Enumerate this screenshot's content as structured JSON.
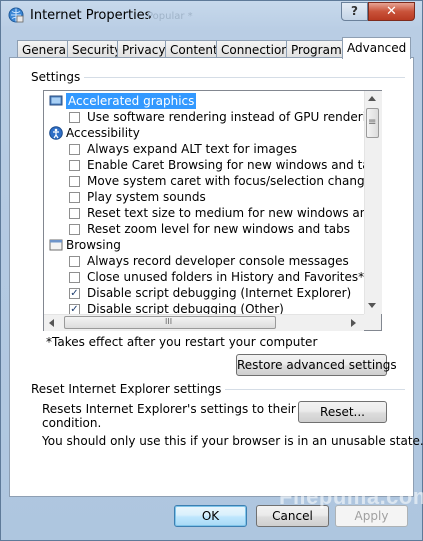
{
  "window": {
    "title": "Internet Properties",
    "background_title": "Popular *",
    "help_glyph": "?",
    "close_glyph": "✕"
  },
  "tabs": [
    {
      "label": "General"
    },
    {
      "label": "Security"
    },
    {
      "label": "Privacy"
    },
    {
      "label": "Content"
    },
    {
      "label": "Connections"
    },
    {
      "label": "Programs"
    },
    {
      "label": "Advanced",
      "active": true
    }
  ],
  "settings": {
    "group_label": "Settings",
    "items": [
      {
        "type": "category",
        "icon": "monitor-icon",
        "label": "Accelerated graphics",
        "selected": true
      },
      {
        "type": "checkbox",
        "label": "Use software rendering instead of GPU rendering*",
        "checked": false
      },
      {
        "type": "category",
        "icon": "accessibility-icon",
        "label": "Accessibility"
      },
      {
        "type": "checkbox",
        "label": "Always expand ALT text for images",
        "checked": false
      },
      {
        "type": "checkbox",
        "label": "Enable Caret Browsing for new windows and tabs",
        "checked": false
      },
      {
        "type": "checkbox",
        "label": "Move system caret with focus/selection changes",
        "checked": false
      },
      {
        "type": "checkbox",
        "label": "Play system sounds",
        "checked": false
      },
      {
        "type": "checkbox",
        "label": "Reset text size to medium for new windows and tabs",
        "checked": false
      },
      {
        "type": "checkbox",
        "label": "Reset zoom level for new windows and tabs",
        "checked": false
      },
      {
        "type": "category",
        "icon": "browsing-icon",
        "label": "Browsing"
      },
      {
        "type": "checkbox",
        "label": "Always record developer console messages",
        "checked": false
      },
      {
        "type": "checkbox",
        "label": "Close unused folders in History and Favorites*",
        "checked": false
      },
      {
        "type": "checkbox",
        "label": "Disable script debugging (Internet Explorer)",
        "checked": true
      },
      {
        "type": "checkbox",
        "label": "Disable script debugging (Other)",
        "checked": true
      }
    ],
    "check_glyph": "✓",
    "hscroll_grip": "III",
    "vscroll_grip": "≡",
    "footnote": "*Takes effect after you restart your computer",
    "restore_button": "Restore advanced settings"
  },
  "reset": {
    "group_label": "Reset Internet Explorer settings",
    "description_line1": "Resets Internet Explorer's settings to their default",
    "description_line2": "condition.",
    "reset_button": "Reset...",
    "warning": "You should only use this if your browser is in an unusable state."
  },
  "buttons": {
    "ok": "OK",
    "cancel": "Cancel",
    "apply": "Apply"
  },
  "watermark": "Filepuma.com"
}
